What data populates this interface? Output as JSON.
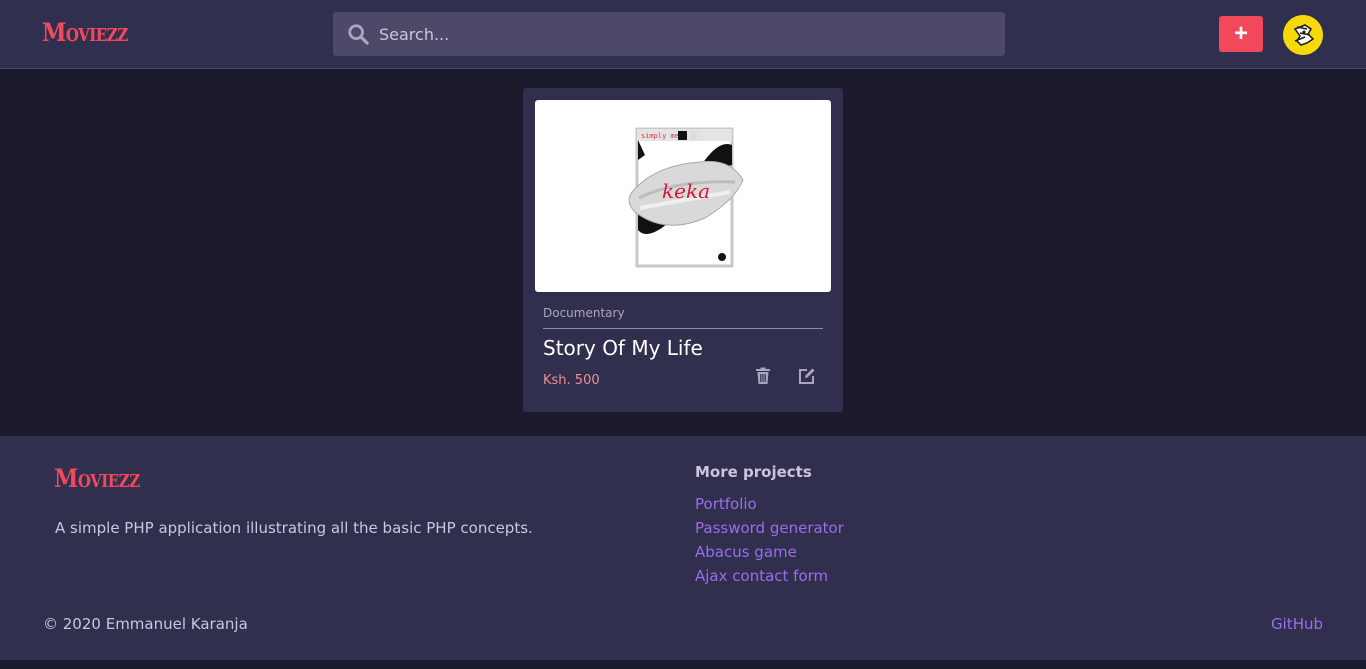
{
  "header": {
    "logo": "Moviezz",
    "search_placeholder": "Search...",
    "add_button_label": "+"
  },
  "movie_card": {
    "poster": {
      "small_caption": "simply me",
      "title_text": "keka"
    },
    "category": "Documentary",
    "title": "Story Of My Life",
    "price": "Ksh. 500"
  },
  "footer": {
    "logo": "Moviezz",
    "description": "A simple PHP application illustrating all the basic PHP concepts.",
    "more_projects_title": "More projects",
    "links": [
      {
        "label": "Portfolio"
      },
      {
        "label": "Password generator"
      },
      {
        "label": "Abacus game"
      },
      {
        "label": "Ajax contact form"
      }
    ],
    "copyright": "© 2020 Emmanuel Karanja",
    "github_label": "GitHub"
  },
  "colors": {
    "accent": "#f1495b",
    "link": "#9b6cf0",
    "surface": "#302f4d",
    "background": "#1c1b2e"
  },
  "icons": {
    "search": "search-icon",
    "add": "plus-icon",
    "delete": "trash-icon",
    "edit": "edit-icon"
  }
}
